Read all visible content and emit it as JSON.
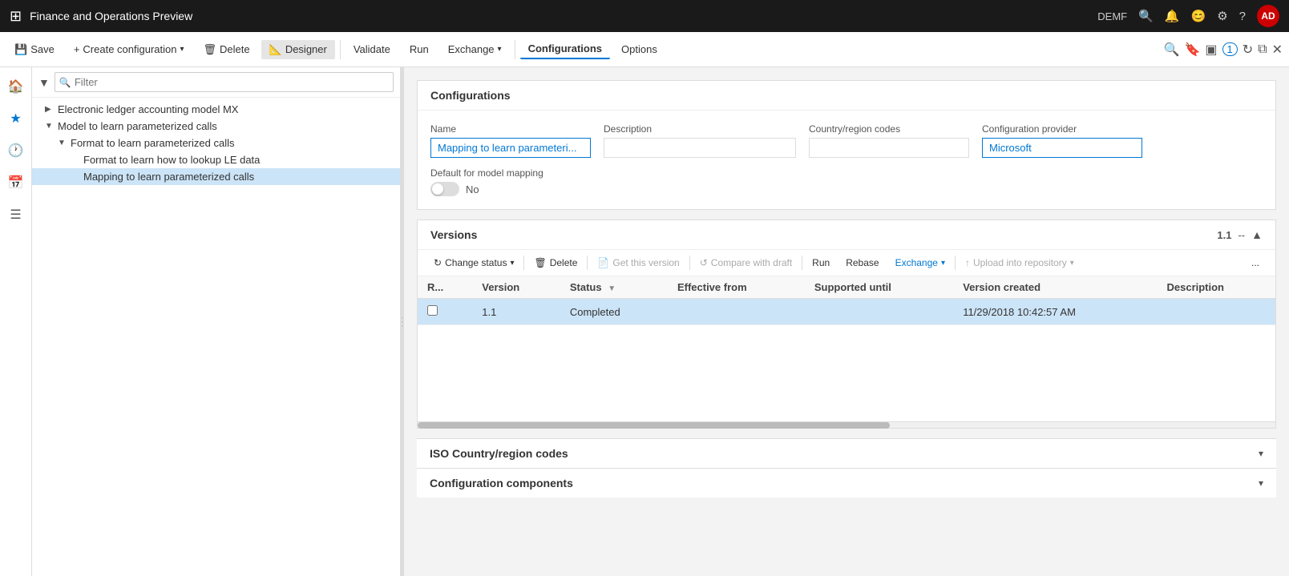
{
  "titleBar": {
    "title": "Finance and Operations Preview",
    "user": "DEMF",
    "userInitials": "AD"
  },
  "commandBar": {
    "save": "Save",
    "createConfig": "Create configuration",
    "delete": "Delete",
    "designer": "Designer",
    "validate": "Validate",
    "run": "Run",
    "exchange": "Exchange",
    "configurations": "Configurations",
    "options": "Options"
  },
  "treePanel": {
    "filterPlaceholder": "Filter",
    "items": [
      {
        "id": "electronic-ledger",
        "label": "Electronic ledger accounting model MX",
        "level": 1,
        "expanded": false,
        "hasChildren": true
      },
      {
        "id": "model-parameterized",
        "label": "Model to learn parameterized calls",
        "level": 1,
        "expanded": true,
        "hasChildren": true
      },
      {
        "id": "format-parameterized",
        "label": "Format to learn parameterized calls",
        "level": 2,
        "expanded": true,
        "hasChildren": true
      },
      {
        "id": "format-lookup",
        "label": "Format to learn how to lookup LE data",
        "level": 3,
        "expanded": false,
        "hasChildren": false
      },
      {
        "id": "mapping-parameterized",
        "label": "Mapping to learn parameterized calls",
        "level": 3,
        "expanded": false,
        "hasChildren": false,
        "selected": true
      }
    ]
  },
  "configurations": {
    "title": "Configurations",
    "fields": {
      "name": {
        "label": "Name",
        "value": "Mapping to learn parameteri..."
      },
      "description": {
        "label": "Description",
        "value": ""
      },
      "countryRegionCodes": {
        "label": "Country/region codes",
        "value": ""
      },
      "configurationProvider": {
        "label": "Configuration provider",
        "value": "Microsoft"
      },
      "defaultForModelMapping": {
        "label": "Default for model mapping",
        "toggleValue": "No"
      }
    }
  },
  "versions": {
    "title": "Versions",
    "versionNumber": "1.1",
    "toolbar": {
      "changeStatus": "Change status",
      "delete": "Delete",
      "getThisVersion": "Get this version",
      "compareWithDraft": "Compare with draft",
      "run": "Run",
      "rebase": "Rebase",
      "exchange": "Exchange",
      "uploadIntoRepository": "Upload into repository",
      "more": "..."
    },
    "table": {
      "columns": [
        "R...",
        "Version",
        "Status",
        "Effective from",
        "Supported until",
        "Version created",
        "Description"
      ],
      "rows": [
        {
          "r": "",
          "version": "1.1",
          "status": "Completed",
          "effectiveFrom": "",
          "supportedUntil": "",
          "versionCreated": "11/29/2018 10:42:57 AM",
          "description": "",
          "selected": true
        }
      ]
    }
  },
  "isoSection": {
    "title": "ISO Country/region codes"
  },
  "configComponents": {
    "title": "Configuration components"
  }
}
